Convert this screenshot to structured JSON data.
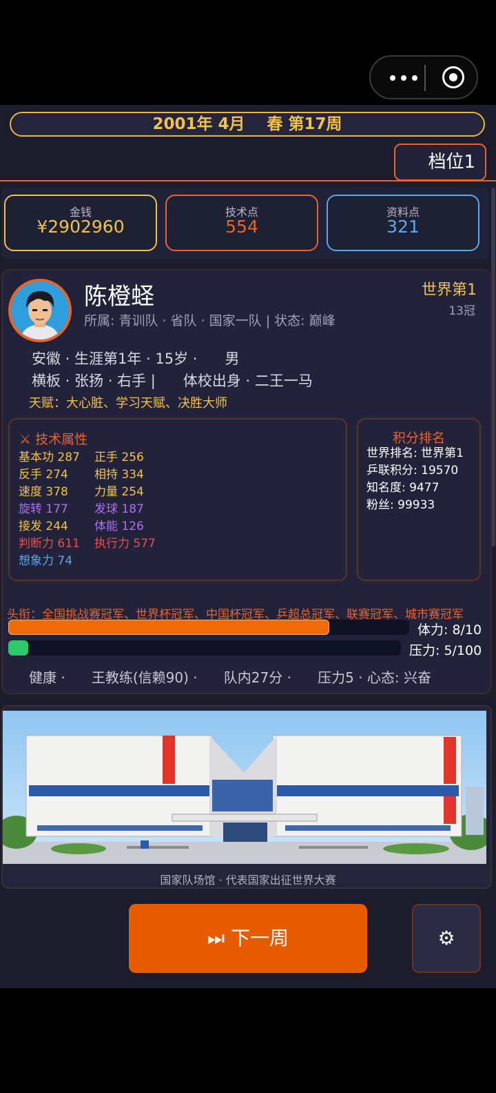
{
  "header": {
    "date": "2001年 4月",
    "season_week": "春 第17周",
    "gear_label": "档位1"
  },
  "stats": {
    "money": {
      "label": "金钱",
      "value": "¥2902960",
      "color": "#f2c14a"
    },
    "tech": {
      "label": "技术点",
      "value": "554",
      "color": "#e8642a"
    },
    "data": {
      "label": "资料点",
      "value": "321",
      "color": "#5aa8f0"
    }
  },
  "player": {
    "name": "陈橙蛏",
    "affiliation": "所属: 青训队 · 省队 · 国家一队 | 状态: 巅峰",
    "world_rank": "世界第1",
    "crowns": "13冠",
    "info_line1": "安徽 · 生涯第1年 · 15岁 ·      男",
    "info_line2": "横板 · 张扬 · 右手 |      体校出身 · 二王一马",
    "talent": "天赋：大心脏、学习天赋、决胜大师"
  },
  "attributes": {
    "title": "⚔ 技术属性",
    "items": [
      {
        "text": "基本功 287",
        "color": "#f2c14a"
      },
      {
        "text": "正手 256",
        "color": "#f2c14a"
      },
      {
        "text": "反手 274",
        "color": "#f2c14a"
      },
      {
        "text": "相持 334",
        "color": "#f2c14a"
      },
      {
        "text": "速度 378",
        "color": "#f2c14a"
      },
      {
        "text": "力量 254",
        "color": "#f2c14a"
      },
      {
        "text": "旋转 177",
        "color": "#b06ef0"
      },
      {
        "text": "发球 187",
        "color": "#b06ef0"
      },
      {
        "text": "接发 244",
        "color": "#f2c14a"
      },
      {
        "text": "体能 126",
        "color": "#b06ef0"
      },
      {
        "text": "判断力 611",
        "color": "#e85050"
      },
      {
        "text": "执行力 577",
        "color": "#e85050"
      },
      {
        "text": "想象力 74",
        "color": "#5aa8f0"
      }
    ]
  },
  "ranking": {
    "title": "积分排名",
    "lines": [
      "世界排名: 世界第1",
      "乒联积分: 19570",
      "知名度: 9477",
      "粉丝: 99933"
    ]
  },
  "honors": "头衔：全国挑战赛冠军、世界杯冠军、中国杯冠军、乒超总冠军、联赛冠军、城市赛冠军",
  "bars": {
    "stamina": {
      "label": "体力: 8/10",
      "fraction": 0.8,
      "color": "#f06a0a"
    },
    "pressure": {
      "label": "压力: 5/100",
      "fraction": 0.05,
      "color": "#2ec96a"
    }
  },
  "status_line": "健康 ·      王教练(信赖90) ·      队内27分 ·      压力5 · 心态: 兴奋",
  "scene": {
    "caption": "国家队场馆 · 代表国家出征世界大赛"
  },
  "actions": {
    "next_week": "⏭ 下一周",
    "settings_icon": "⚙"
  }
}
